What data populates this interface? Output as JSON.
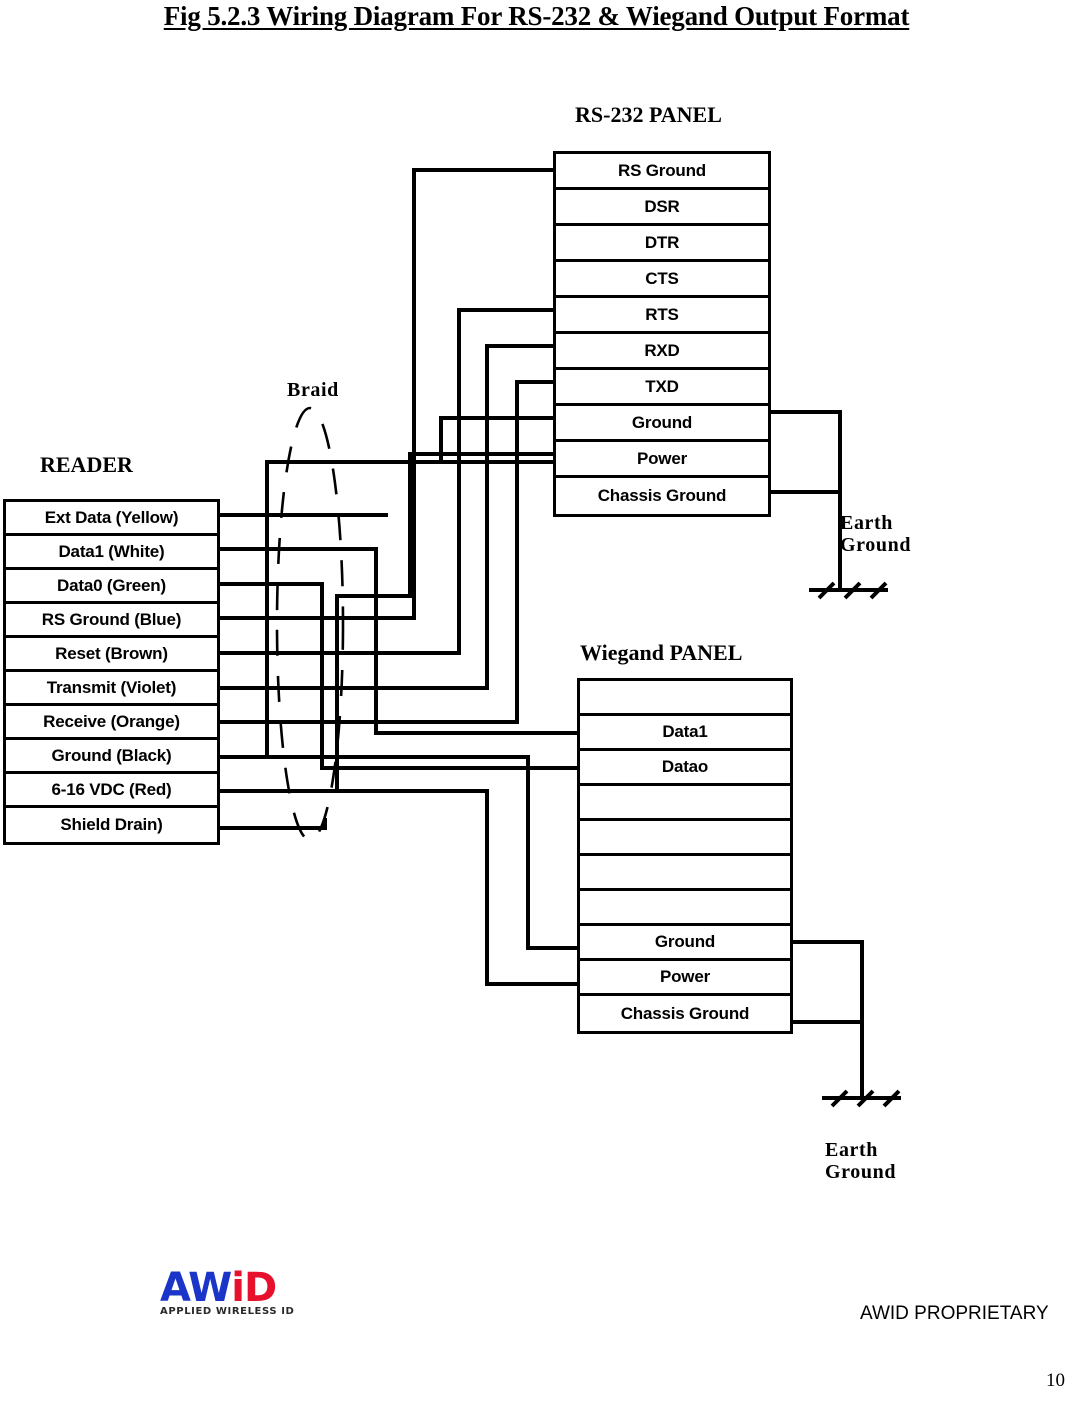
{
  "document": {
    "figure_title": "Fig 5.2.3 Wiring Diagram For RS-232 & Wiegand Output Format",
    "page_number": "10",
    "proprietary_notice": "AWID PROPRIETARY"
  },
  "logo": {
    "part1": "AW",
    "part2": "iD",
    "tagline": "APPLIED WIRELESS ID",
    "blue": "#1a35c8",
    "red": "#e8112d"
  },
  "labels": {
    "braid": "Braid",
    "earth_ground_top": "Earth\nGround",
    "earth_ground_bottom": "Earth\nGround"
  },
  "reader_panel": {
    "heading": "READER",
    "rows": [
      {
        "label": "Ext Data  (Yellow)"
      },
      {
        "label": "Data1 (White)"
      },
      {
        "label": "Data0 (Green)"
      },
      {
        "label": "RS Ground (Blue)"
      },
      {
        "label": "Reset (Brown)"
      },
      {
        "label": "Transmit (Violet)"
      },
      {
        "label": "Receive (Orange)"
      },
      {
        "label": "Ground (Black)"
      },
      {
        "label": "6-16 VDC (Red)"
      },
      {
        "label": "Shield Drain)"
      }
    ]
  },
  "rs232_panel": {
    "heading": "RS-232 PANEL",
    "rows": [
      {
        "label": "RS Ground"
      },
      {
        "label": "DSR"
      },
      {
        "label": "DTR"
      },
      {
        "label": "CTS"
      },
      {
        "label": "RTS"
      },
      {
        "label": "RXD"
      },
      {
        "label": "TXD"
      },
      {
        "label": "Ground"
      },
      {
        "label": "Power"
      },
      {
        "label": "Chassis Ground"
      }
    ]
  },
  "wiegand_panel": {
    "heading": "Wiegand PANEL",
    "rows": [
      {
        "label": ""
      },
      {
        "label": "Data1"
      },
      {
        "label": "Datao"
      },
      {
        "label": ""
      },
      {
        "label": ""
      },
      {
        "label": ""
      },
      {
        "label": ""
      },
      {
        "label": "Ground"
      },
      {
        "label": "Power"
      },
      {
        "label": "Chassis Ground"
      }
    ]
  }
}
